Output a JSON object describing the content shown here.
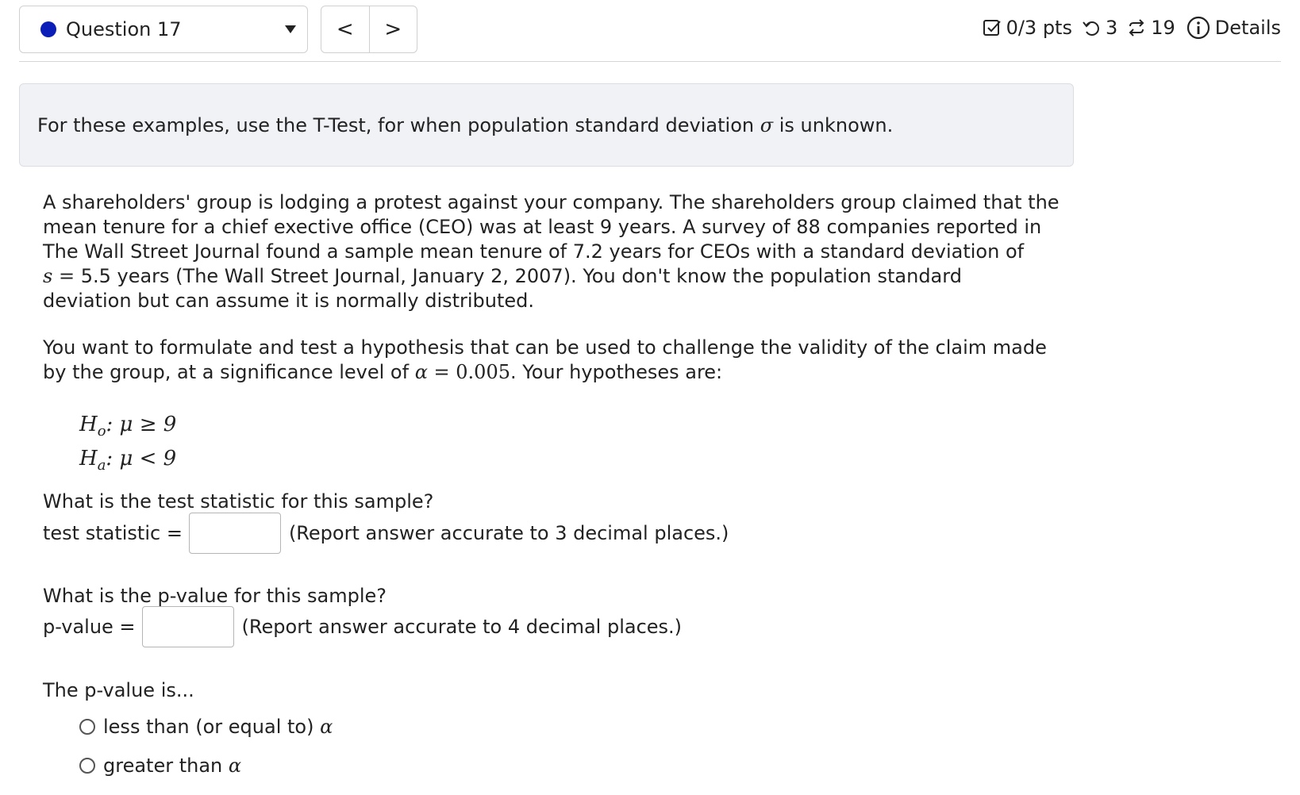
{
  "header": {
    "question_label": "Question 17",
    "nav_prev": "<",
    "nav_next": ">",
    "score": "0/3 pts",
    "attempts": "3",
    "submissions": "19",
    "details": "Details"
  },
  "info": {
    "text_before": "For these examples, use the T-Test, for when population standard deviation ",
    "sigma": "σ",
    "text_after": " is unknown."
  },
  "problem": {
    "para1_line1": "A shareholders' group is lodging a protest against your company. The shareholders group claimed that the",
    "para1_line2": "mean tenure for a chief exective office (CEO) was at least 9 years. A survey of 88 companies reported in",
    "para1_line3": "The Wall Street Journal found a sample mean tenure of 7.2 years for CEOs with a standard deviation of",
    "s_symbol": "s =",
    "para1_line4_rest": " 5.5 years (The Wall Street Journal, January 2, 2007). You don't know the population standard",
    "para1_line5": "deviation but can assume it is normally distributed.",
    "para2_line1": "You want to formulate and test a hypothesis that can be used to challenge the validity of the claim made",
    "para2_line2_start": "by the group, at a significance level of ",
    "alpha_eq": "α = ",
    "alpha_value": "0.005",
    "para2_line2_end": ". Your hypotheses are:"
  },
  "hypotheses": {
    "h0_symbol": "H",
    "h0_sub": "o",
    "h0_rest": ": μ ≥ 9",
    "ha_symbol": "H",
    "ha_sub": "a",
    "ha_rest": ": μ < 9"
  },
  "question1": {
    "prompt": "What is the test statistic for this sample?",
    "label": "test statistic =",
    "value": "",
    "note": "(Report answer accurate to 3 decimal places.)"
  },
  "question2": {
    "prompt": "What is the p-value for this sample?",
    "label": "p-value =",
    "value": "",
    "note": "(Report answer accurate to 4 decimal places.)"
  },
  "question3": {
    "prompt": "The p-value is...",
    "options": [
      {
        "text": "less than (or equal to) ",
        "symbol": "α"
      },
      {
        "text": "greater than ",
        "symbol": "α"
      }
    ]
  },
  "colors": {
    "question_dot": "#0b1fb8",
    "info_bg": "#f1f2f6"
  }
}
